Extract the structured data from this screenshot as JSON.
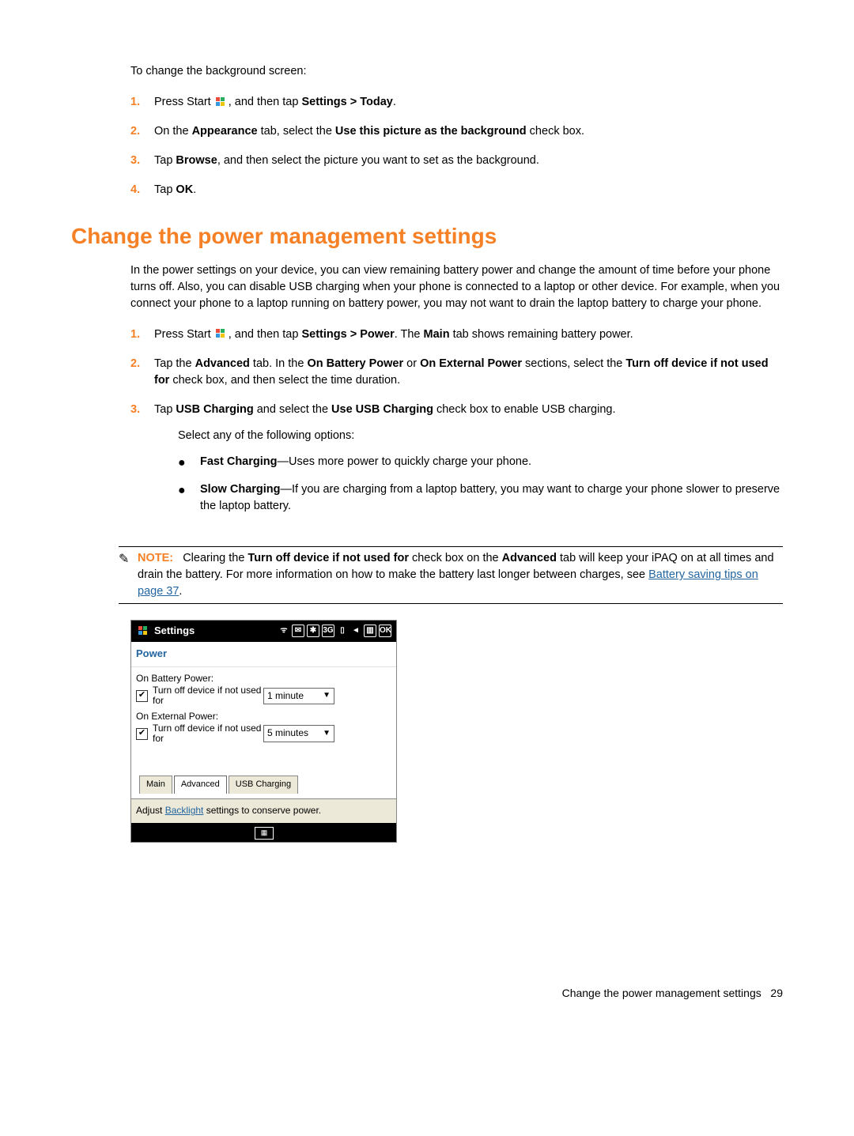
{
  "intro": "To change the background screen:",
  "list1": [
    {
      "num": "1.",
      "pre": "Press Start ",
      "icon": true,
      "post": ", and then tap ",
      "bold": "Settings > Today",
      "tail": "."
    },
    {
      "num": "2.",
      "pre": "On the ",
      "bold": "Appearance",
      "mid": " tab, select the ",
      "bold2": "Use this picture as the background",
      "tail": " check box."
    },
    {
      "num": "3.",
      "pre": "Tap ",
      "bold": "Browse",
      "tail": ", and then select the picture you want to set as the background."
    },
    {
      "num": "4.",
      "pre": "Tap ",
      "bold": "OK",
      "tail": "."
    }
  ],
  "heading": "Change the power management settings",
  "para1": "In the power settings on your device, you can view remaining battery power and change the amount of time before your phone turns off. Also, you can disable USB charging when your phone is connected to a laptop or other device. For example, when you connect your phone to a laptop running on battery power, you may not want to drain the laptop battery to charge your phone.",
  "list2": [
    {
      "num": "1.",
      "pre": "Press Start ",
      "icon": true,
      "mid1": ", and then tap ",
      "b1": "Settings > Power",
      "mid2": ". The ",
      "b2": "Main",
      "tail": " tab shows remaining battery power."
    },
    {
      "num": "2.",
      "pre": "Tap the ",
      "b1": "Advanced",
      "mid1": " tab. In the ",
      "b2": "On Battery Power",
      "mid2": " or ",
      "b3": "On External Power",
      "mid3": " sections, select the ",
      "b4": "Turn off device if not used for",
      "tail": " check box, and then select the time duration."
    },
    {
      "num": "3.",
      "pre": "Tap ",
      "b1": "USB Charging",
      "mid1": " and select the ",
      "b2": "Use USB Charging",
      "tail": " check box to enable USB charging.",
      "sub_intro": "Select any of the following options:",
      "bullets": [
        {
          "b": "Fast Charging",
          "t": "—Uses more power to quickly charge your phone."
        },
        {
          "b": "Slow Charging",
          "t": "—If you are charging from a laptop battery, you may want to charge your phone slower to preserve the laptop battery."
        }
      ]
    }
  ],
  "note": {
    "label": "NOTE:",
    "pre": "Clearing the ",
    "b1": "Turn off device if not used for",
    "mid1": " check box on the ",
    "b2": "Advanced",
    "mid2": " tab will keep your iPAQ on at all times and drain the battery. For more information on how to make the battery last longer between charges, see ",
    "link": "Battery saving tips on page 37",
    "tail": "."
  },
  "screenshot": {
    "title": "Settings",
    "status_icons": [
      "ᯤ",
      "✉",
      "✱",
      "3G",
      "▯",
      "◄",
      "▥",
      "OK"
    ],
    "header2": "Power",
    "section1": "On Battery Power:",
    "chk1": "Turn off device if not used for",
    "dd1": "1 minute",
    "section2": "On External Power:",
    "chk2": "Turn off device if not used for",
    "dd2": "5 minutes",
    "tabs": [
      "Main",
      "Advanced",
      "USB Charging"
    ],
    "active_tab": 1,
    "linkrow_pre": "Adjust ",
    "linkrow_link": "Backlight",
    "linkrow_post": " settings to conserve power."
  },
  "footer": {
    "text": "Change the power management settings",
    "page": "29"
  }
}
